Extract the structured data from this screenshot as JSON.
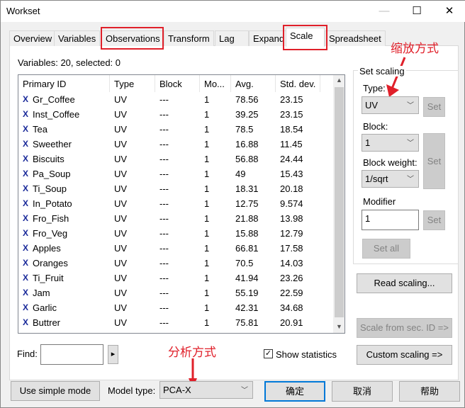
{
  "window": {
    "title": "Workset",
    "minimize": "—",
    "maximize": "☐",
    "close": "✕"
  },
  "tabs": [
    {
      "label": "Overview"
    },
    {
      "label": "Variables"
    },
    {
      "label": "Observations",
      "highlighted": true
    },
    {
      "label": "Transform"
    },
    {
      "label": "Lag"
    },
    {
      "label": "Expand"
    },
    {
      "label": "Scale",
      "active": true,
      "highlighted": true
    },
    {
      "label": "Spreadsheet"
    }
  ],
  "summary": "Variables: 20, selected: 0",
  "table": {
    "columns": [
      "Primary ID",
      "Type",
      "Block",
      "Mo...",
      "Avg.",
      "Std. dev."
    ],
    "rows": [
      [
        "Gr_Coffee",
        "UV",
        "---",
        "1",
        "78.56",
        "23.15"
      ],
      [
        "Inst_Coffee",
        "UV",
        "---",
        "1",
        "39.25",
        "23.15"
      ],
      [
        "Tea",
        "UV",
        "---",
        "1",
        "78.5",
        "18.54"
      ],
      [
        "Sweether",
        "UV",
        "---",
        "1",
        "16.88",
        "11.45"
      ],
      [
        "Biscuits",
        "UV",
        "---",
        "1",
        "56.88",
        "24.44"
      ],
      [
        "Pa_Soup",
        "UV",
        "---",
        "1",
        "49",
        "15.43"
      ],
      [
        "Ti_Soup",
        "UV",
        "---",
        "1",
        "18.31",
        "20.18"
      ],
      [
        "In_Potato",
        "UV",
        "---",
        "1",
        "12.75",
        "9.574"
      ],
      [
        "Fro_Fish",
        "UV",
        "---",
        "1",
        "21.88",
        "13.98"
      ],
      [
        "Fro_Veg",
        "UV",
        "---",
        "1",
        "15.88",
        "12.79"
      ],
      [
        "Apples",
        "UV",
        "---",
        "1",
        "66.81",
        "17.58"
      ],
      [
        "Oranges",
        "UV",
        "---",
        "1",
        "70.5",
        "14.03"
      ],
      [
        "Ti_Fruit",
        "UV",
        "---",
        "1",
        "41.94",
        "23.26"
      ],
      [
        "Jam",
        "UV",
        "---",
        "1",
        "55.19",
        "22.59"
      ],
      [
        "Garlic",
        "UV",
        "---",
        "1",
        "42.31",
        "34.68"
      ],
      [
        "Buttrer",
        "UV",
        "---",
        "1",
        "75.81",
        "20.91"
      ]
    ],
    "row_icon": "x-variable-icon",
    "row_icon_glyph": "X"
  },
  "scaling": {
    "group_label": "Set scaling",
    "type_label": "Type:",
    "type_value": "UV",
    "block_label": "Block:",
    "block_value": "1",
    "weight_label": "Block weight:",
    "weight_value": "1/sqrt",
    "modifier_label": "Modifier",
    "modifier_value": "1",
    "set": "Set",
    "set_all": "Set all"
  },
  "read_scaling": "Read scaling...",
  "scale_sec": "Scale from sec. ID =>",
  "custom_scaling": "Custom scaling =>",
  "find_label": "Find:",
  "find_value": "",
  "find_arrow": "▸",
  "show_statistics": {
    "label": "Show statistics",
    "checked": true
  },
  "bottom": {
    "simple_mode": "Use simple mode",
    "model_type_label": "Model type:",
    "model_type": "PCA-X",
    "ok": "确定",
    "cancel": "取消",
    "help": "帮助"
  },
  "annotations": {
    "scale_note": "缩放方式",
    "model_note": "分析方式",
    "color": "#e0202a"
  }
}
